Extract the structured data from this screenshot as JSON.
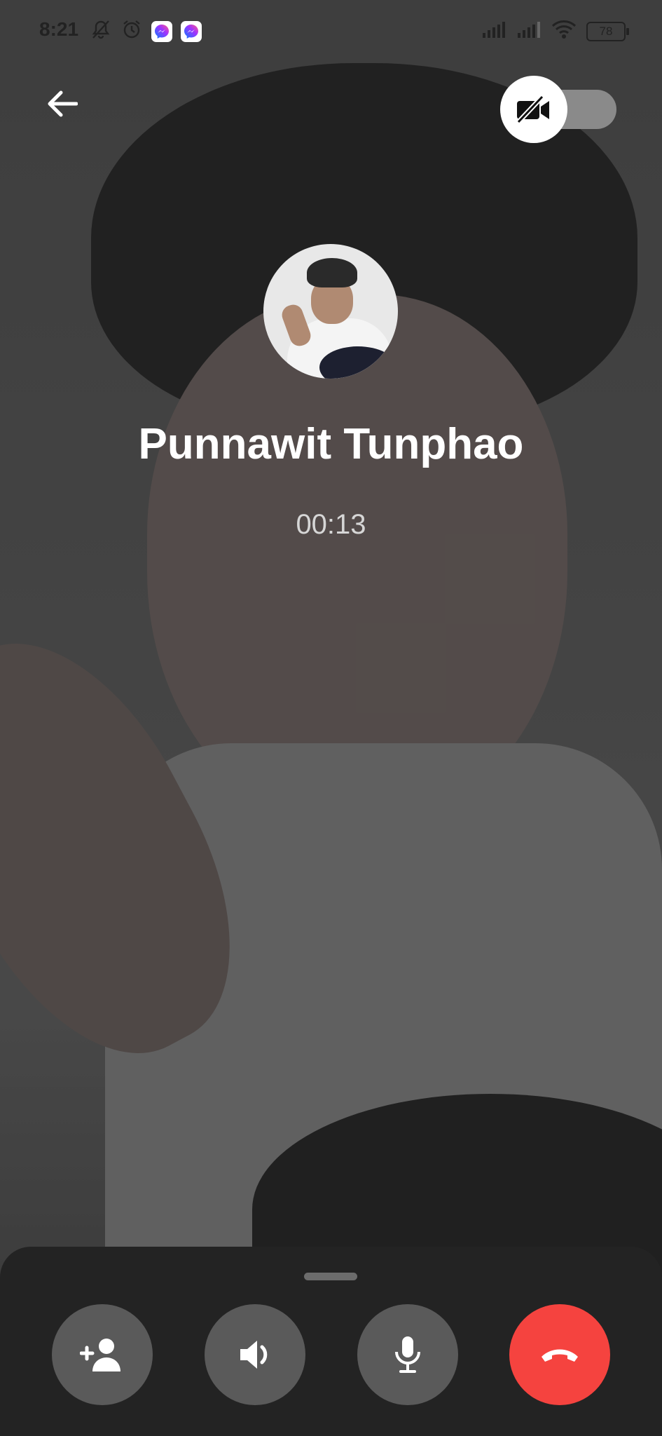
{
  "status_bar": {
    "time": "8:21",
    "battery": "78",
    "icons": [
      "mute-icon",
      "alarm-icon",
      "messenger-icon",
      "messenger-icon",
      "signal-icon",
      "signal-icon",
      "wifi-icon",
      "battery-icon"
    ]
  },
  "call": {
    "contact_name": "Punnawit Tunphao",
    "duration": "00:13",
    "video_enabled": false
  },
  "controls": [
    {
      "name": "add-person",
      "icon": "add-person-icon"
    },
    {
      "name": "speaker",
      "icon": "speaker-icon"
    },
    {
      "name": "microphone",
      "icon": "microphone-icon"
    },
    {
      "name": "end-call",
      "icon": "end-call-icon",
      "color": "#f5433f"
    }
  ],
  "colors": {
    "end_call": "#f5433f",
    "panel_bg": "#232323",
    "control_bg": "#5a5a5a"
  }
}
